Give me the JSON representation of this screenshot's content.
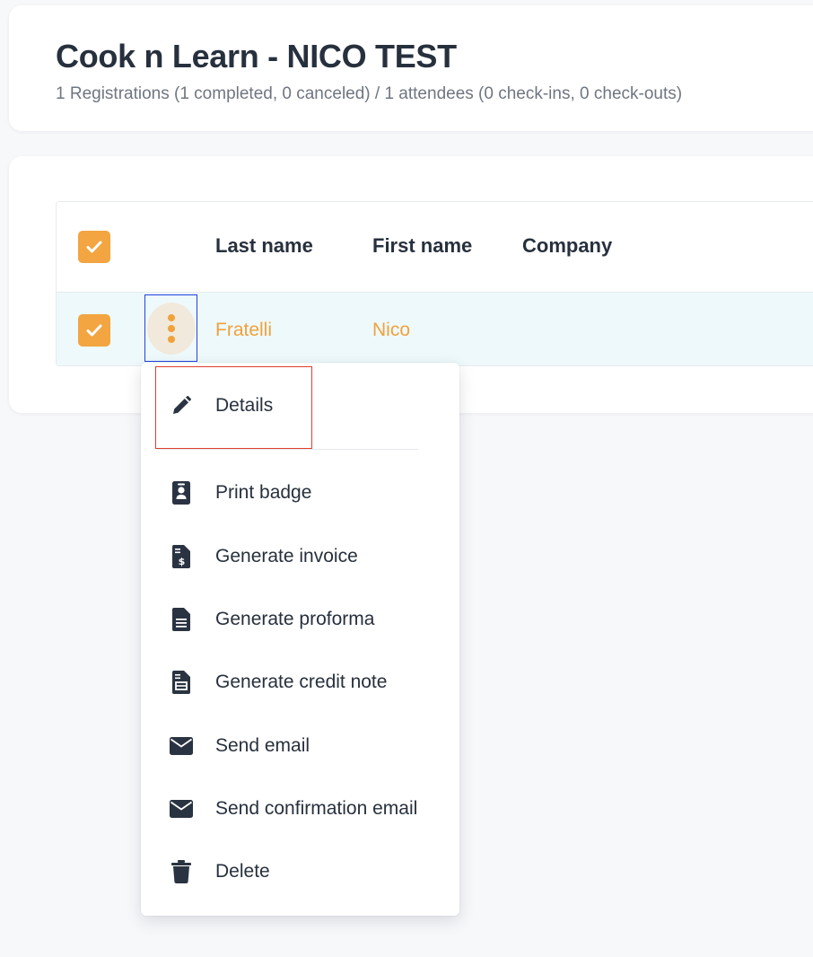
{
  "event": {
    "title": "Cook n Learn - NICO TEST",
    "summary": "1 Registrations (1 completed, 0 canceled) / 1 attendees (0 check-ins, 0 check-outs)"
  },
  "table": {
    "columns": [
      "Last name",
      "First name",
      "Company"
    ],
    "rows": [
      {
        "last_name": "Fratelli",
        "first_name": "Nico",
        "company": ""
      }
    ]
  },
  "menu": {
    "items": [
      {
        "label": "Details",
        "icon": "pencil-icon"
      },
      {
        "label": "Print badge",
        "icon": "badge-icon"
      },
      {
        "label": "Generate invoice",
        "icon": "invoice-icon"
      },
      {
        "label": "Generate proforma",
        "icon": "document-icon"
      },
      {
        "label": "Generate credit note",
        "icon": "credit-note-icon"
      },
      {
        "label": "Send email",
        "icon": "envelope-icon"
      },
      {
        "label": "Send confirmation email",
        "icon": "envelope-icon"
      },
      {
        "label": "Delete",
        "icon": "trash-icon"
      }
    ]
  },
  "colors": {
    "accent": "#f2a541",
    "text": "#27303d",
    "row_highlight": "#eef9fb",
    "focus_outline": "#2442e0",
    "annotation_outline": "#e0402a"
  }
}
